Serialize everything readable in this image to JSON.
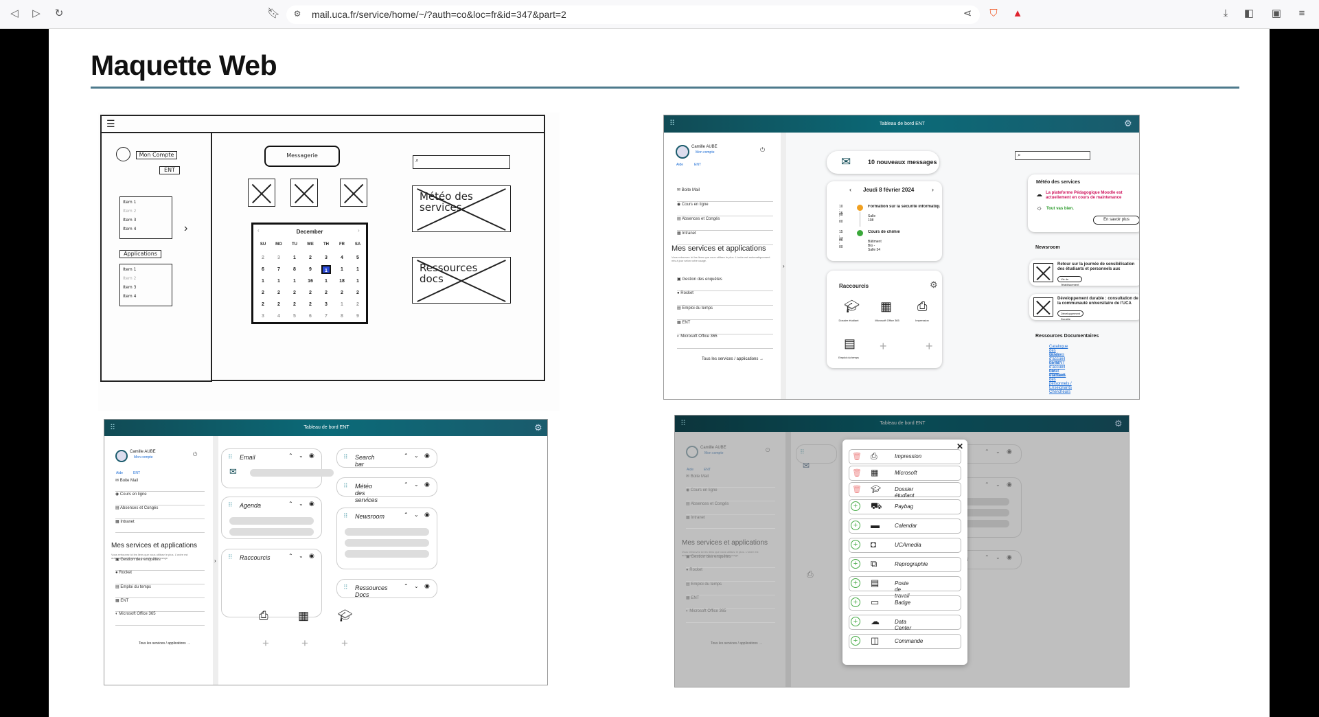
{
  "browser": {
    "url": "mail.uca.fr/service/home/~/?auth=co&loc=fr&id=347&part=2"
  },
  "page": {
    "title": "Maquette Web"
  },
  "sketch": {
    "menu_icon": "hamburger-icon",
    "mon_compte": "Mon Compte",
    "ent": "ENT",
    "applications": "Applications",
    "messagerie": "Messagerie",
    "list1": [
      "Item 1",
      "Item 2",
      "Item 3",
      "Item 4"
    ],
    "list2": [
      "Item 1",
      "Item 2",
      "Item 3",
      "Item 4"
    ],
    "calendar": {
      "month": "December",
      "days": [
        "SU",
        "MO",
        "TU",
        "WE",
        "TH",
        "FR",
        "SA"
      ],
      "rows": [
        [
          "2",
          "3",
          "1",
          "2",
          "3",
          "4",
          "5"
        ],
        [
          "6",
          "7",
          "8",
          "9",
          "1",
          "1",
          "1"
        ],
        [
          "1",
          "1",
          "1",
          "16",
          "1",
          "18",
          "1"
        ],
        [
          "2",
          "2",
          "2",
          "2",
          "2",
          "2",
          "2"
        ],
        [
          "2",
          "2",
          "2",
          "2",
          "3",
          "1",
          "2"
        ],
        [
          "3",
          "4",
          "5",
          "6",
          "7",
          "8",
          "9"
        ]
      ]
    },
    "meteo": "Météo des services",
    "ressources": "Ressources docs"
  },
  "dash": {
    "header": "Tableau de bord ENT",
    "user": "Camille AUBE",
    "mon_compte": "Mon compte",
    "aide": "Aide",
    "ent": "ENT",
    "nav": [
      "Boite Mail",
      "Cours en ligne",
      "Absences et Congés",
      "Intranet"
    ],
    "services_title": "Mes services et applications",
    "services_desc": "Vous retrouvez ici les liens que vous utilisez le plus. L'ordre est automatiquement mis à jour selon votre usage.",
    "services": [
      "Gestion des enquêtes",
      "Rocket",
      "Emploi du temps",
      "ENT",
      "Microsoft Office 365"
    ],
    "all_services": "Tous les services / applications →",
    "messages": "10 nouveaux messages",
    "date": "Jeudi 8 février 2024",
    "events": [
      {
        "start": "10 : 00",
        "end": "15 : 00",
        "title": "Formation sur la sécurité informatique",
        "place": "Salle 108",
        "color": "#f0a020"
      },
      {
        "start": "15 : 00",
        "end": "17 : 00",
        "title": "Cours de chimie",
        "place": "Bâtiment Bio - Salle 34",
        "color": "#3aa83a"
      }
    ],
    "raccourcis": "Raccourcis",
    "shortcuts": [
      "Dossier étudiant",
      "Microsoft Office 365",
      "Impression",
      "Emploi du temps"
    ],
    "meteo_title": "Météo des services",
    "meteo_alert": "La plateforme Pédagogique Moodle est actuellement en cours de maintenance",
    "meteo_ok": "Tout vas bien.",
    "savoir": "En savoir plus",
    "newsroom": "Newsroom",
    "news": [
      {
        "title": "Retour sur la journée de sensibilisation des étudiants et personnels aux",
        "tag": "Vie de l'établissement"
      },
      {
        "title": "Développement durable : consultation de la communauté universitaire de l'UCA",
        "tag": "Développement Durable"
      }
    ],
    "ressources_title": "Ressources Documentaires",
    "links": [
      "Catalogue des services",
      "Guide d'accueil de l'ENT",
      "Livret d'accueil des étudiants",
      "Livret d'accueil des personnels / Enseignants Chercheurs"
    ]
  },
  "widgets": {
    "email": "Email",
    "agenda": "Agenda",
    "raccourcis": "Raccourcis",
    "search": "Search bar",
    "meteo": "Météo des services",
    "newsroom": "Newsroom",
    "ressources": "Ressources Docs"
  },
  "modal": {
    "close": "✕",
    "remove": [
      "Impression",
      "Microsoft",
      "Dossier étudiant"
    ],
    "add": [
      "Paybag",
      "Calendar",
      "UCAmedia",
      "Reprographie",
      "Poste de travail",
      "Badge",
      "Data Center",
      "Commande"
    ]
  }
}
